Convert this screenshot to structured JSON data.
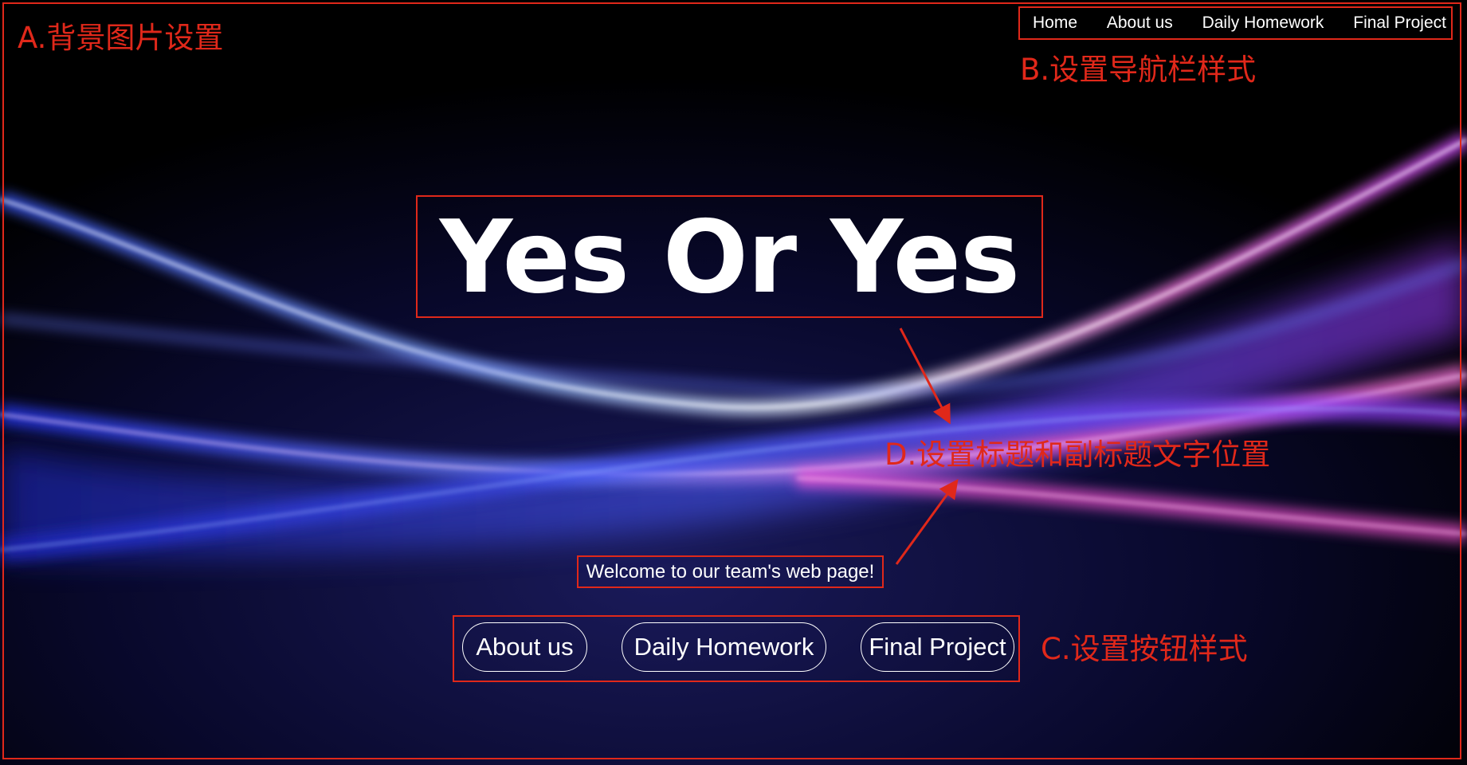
{
  "nav": {
    "items": [
      {
        "label": "Home"
      },
      {
        "label": "About us"
      },
      {
        "label": "Daily Homework"
      },
      {
        "label": "Final Project"
      }
    ]
  },
  "hero": {
    "title": "Yes Or Yes",
    "subtitle": "Welcome to our team's web page!"
  },
  "buttons": {
    "about": "About us",
    "daily": "Daily Homework",
    "final": "Final Project"
  },
  "annotations": {
    "a": "A.背景图片设置",
    "b": "B.设置导航栏样式",
    "c": "C.设置按钮样式",
    "d": "D.设置标题和副标题文字位置"
  },
  "colors": {
    "annotation_red": "#e0281a",
    "background": "#000000",
    "wave_blue": "#4a6bff",
    "wave_pink": "#ff4fd8",
    "text": "#ffffff"
  }
}
